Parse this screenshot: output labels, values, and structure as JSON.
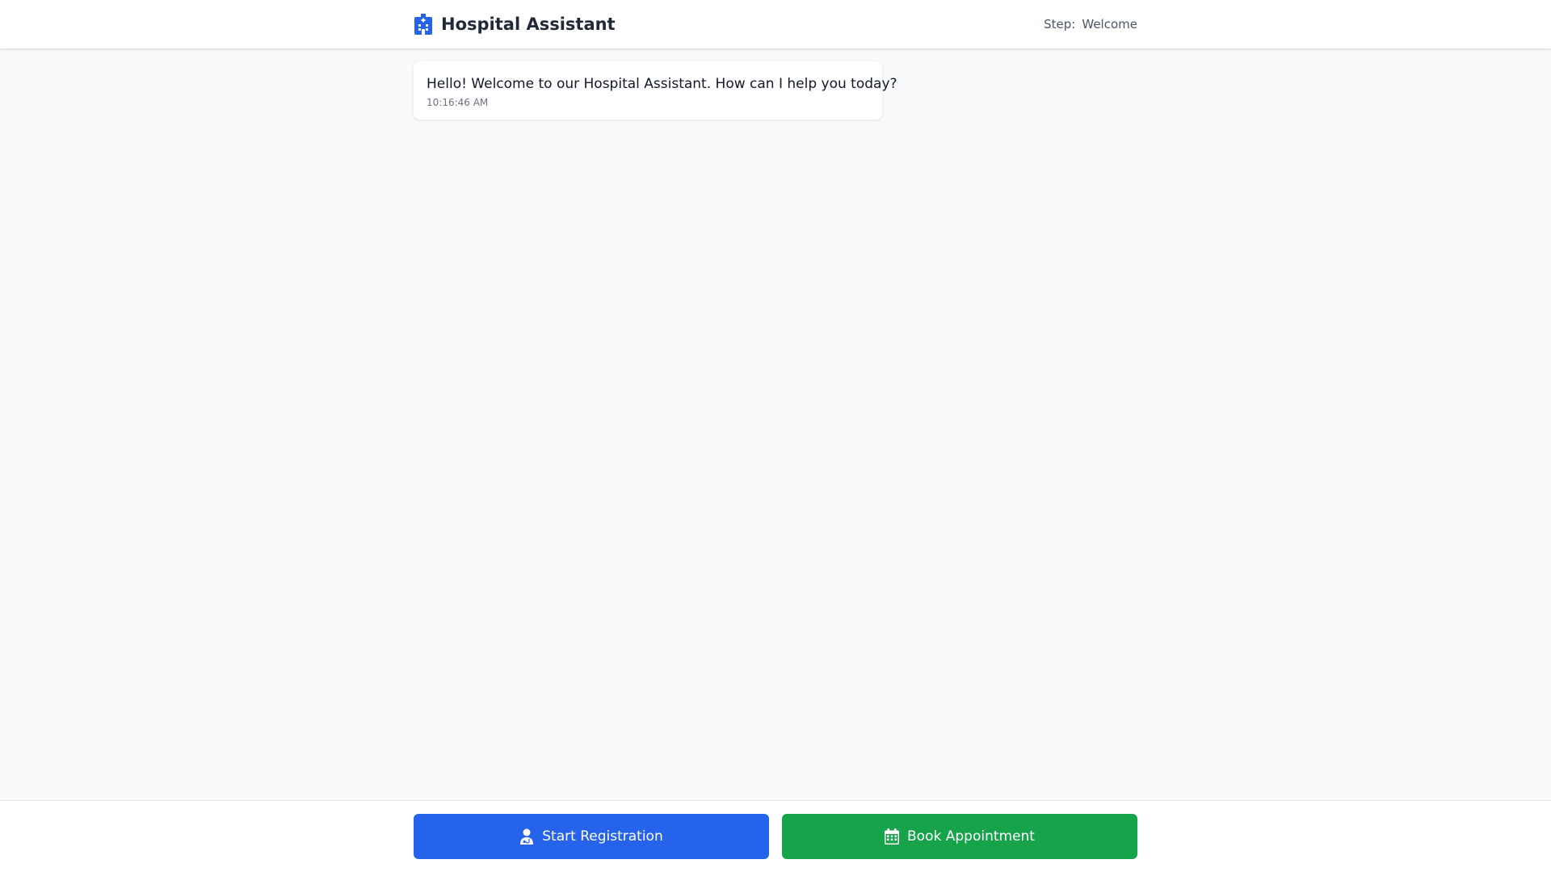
{
  "header": {
    "title": "Hospital Assistant",
    "logo_icon": "hospital-icon",
    "step_label": "Step:",
    "step_value": "Welcome"
  },
  "chat": {
    "messages": [
      {
        "sender": "assistant",
        "text": "Hello! Welcome to our Hospital Assistant. How can I help you today?",
        "time": "10:16:46 AM"
      }
    ]
  },
  "actions": {
    "start_registration": {
      "label": "Start Registration",
      "icon": "user-doctor-icon"
    },
    "book_appointment": {
      "label": "Book Appointment",
      "icon": "calendar-icon"
    }
  },
  "colors": {
    "primary": "#2563eb",
    "success": "#16a34a",
    "background": "#f8fafc"
  }
}
